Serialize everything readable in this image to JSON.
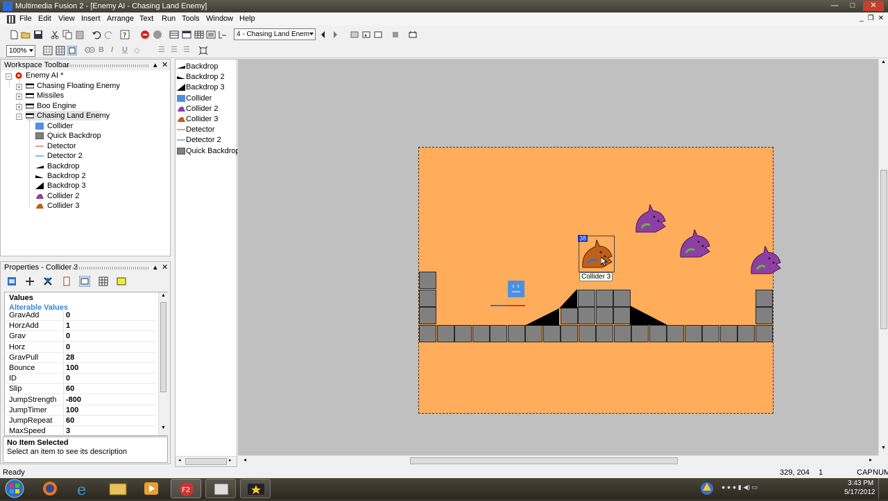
{
  "window": {
    "title": "Multimedia Fusion 2 - [Enemy AI - Chasing Land Enemy]",
    "minimize": "—",
    "maximize": "□",
    "close": "✕"
  },
  "menu": [
    "File",
    "Edit",
    "View",
    "Insert",
    "Arrange",
    "Text",
    "Run",
    "Tools",
    "Window",
    "Help"
  ],
  "toolbar": {
    "frame_select": "4 - Chasing Land Enem",
    "zoom": "100%"
  },
  "workspace": {
    "title": "Workspace Toolbar",
    "app": "Enemy AI *",
    "frames": [
      "Chasing Floating Enemy",
      "Missiles",
      "Boo Engine",
      "Chasing Land Enemy"
    ],
    "objects": [
      "Collider",
      "Quick Backdrop",
      "Detector",
      "Detector 2",
      "Backdrop",
      "Backdrop 2",
      "Backdrop 3",
      "Collider 2",
      "Collider 3"
    ]
  },
  "object_list": [
    "Backdrop",
    "Backdrop 2",
    "Backdrop 3",
    "Collider",
    "Collider 2",
    "Collider 3",
    "Detector",
    "Detector 2",
    "Quick Backdrop"
  ],
  "properties": {
    "title": "Properties - Collider 3",
    "section": "Values",
    "subsection": "Alterable Values",
    "rows": [
      {
        "key": "GravAdd",
        "value": "0"
      },
      {
        "key": "HorzAdd",
        "value": "1"
      },
      {
        "key": "Grav",
        "value": "0"
      },
      {
        "key": "Horz",
        "value": "0"
      },
      {
        "key": "GravPull",
        "value": "28"
      },
      {
        "key": "Bounce",
        "value": "100"
      },
      {
        "key": "ID",
        "value": "0"
      },
      {
        "key": "Slip",
        "value": "60"
      },
      {
        "key": "JumpStrength",
        "value": "-800"
      },
      {
        "key": "JumpTimer",
        "value": "100"
      },
      {
        "key": "JumpRepeat",
        "value": "60"
      },
      {
        "key": "MaxSpeed",
        "value": "3"
      }
    ],
    "info_title": "No Item Selected",
    "info_text": "Select an item to see its description"
  },
  "editor": {
    "selected_label": "Collider 3",
    "selected_badge": "38"
  },
  "status": {
    "left": "Ready",
    "coords": "329, 204",
    "layer": "1",
    "cap": "CAP",
    "num": "NUM"
  },
  "taskbar": {
    "time": "3:43 PM",
    "date": "5/17/2012"
  },
  "colors": {
    "frame_bg": "#ffad5b",
    "editor_bg": "#c0c0c0",
    "tile": "#808080",
    "enemy_purple": "#8e3fa3",
    "enemy_orange": "#c06018",
    "collider_blue": "#4f8fe0"
  }
}
